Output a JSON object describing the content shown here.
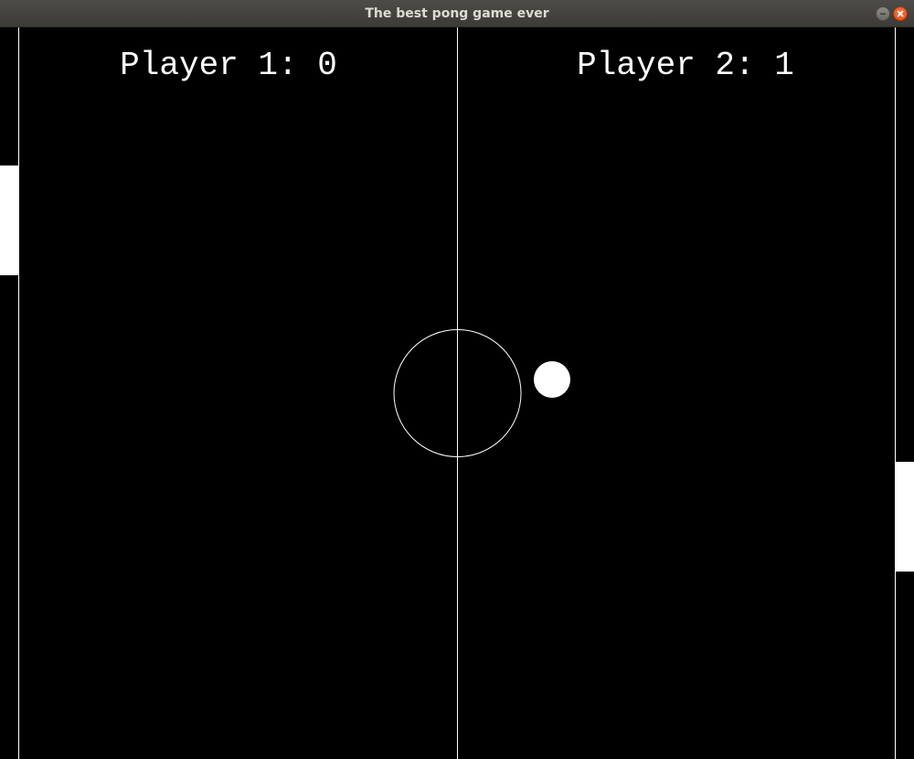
{
  "window": {
    "title": "The best pong game ever",
    "buttons": {
      "minimize_icon": "minimize-icon",
      "close_icon": "close-icon"
    }
  },
  "game": {
    "background_color": "#000000",
    "foreground_color": "#ffffff",
    "player1": {
      "label": "Player 1: 0",
      "score": 0
    },
    "player2": {
      "label": "Player 2: 1",
      "score": 1
    }
  }
}
